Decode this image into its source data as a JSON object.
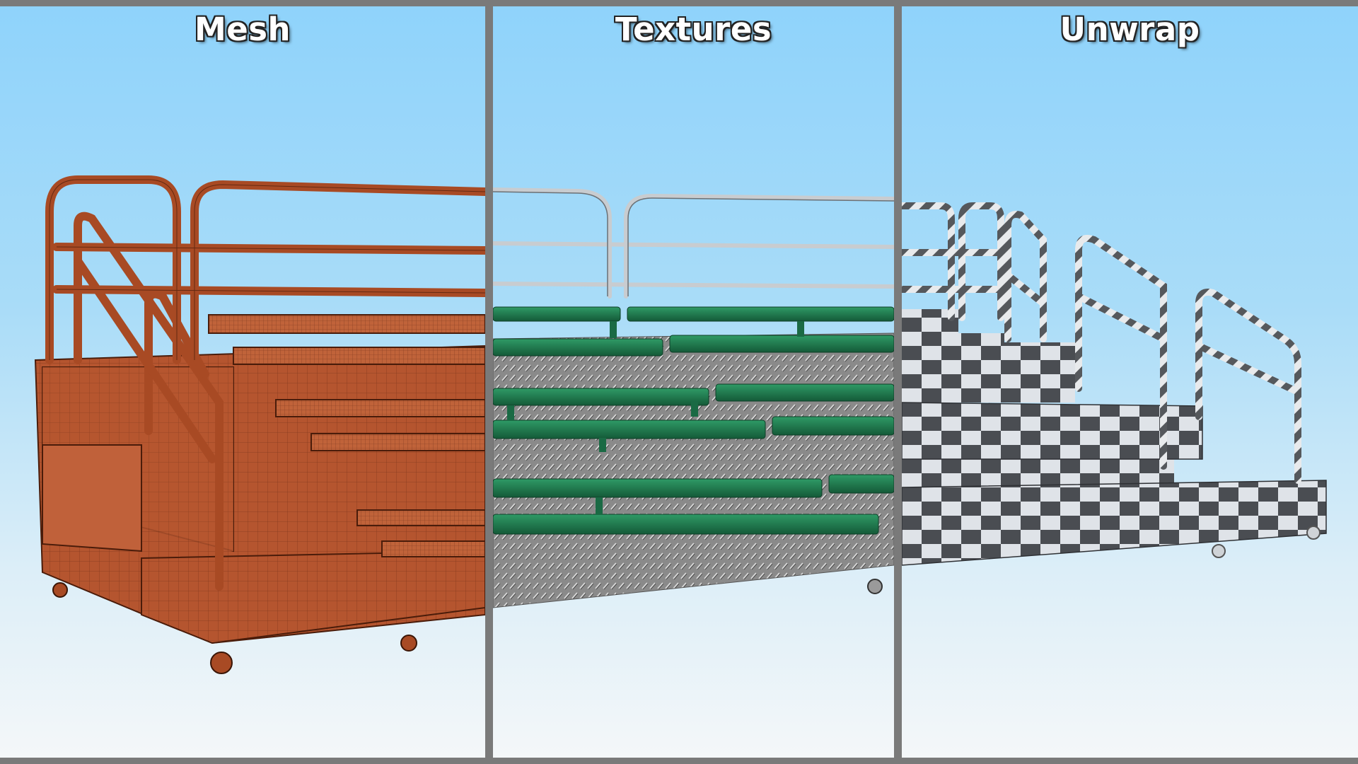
{
  "panels": [
    {
      "id": "mesh",
      "title": "Mesh"
    },
    {
      "id": "textures",
      "title": "Textures"
    },
    {
      "id": "unwrap",
      "title": "Unwrap"
    }
  ],
  "colors": {
    "frame": "#7a7a7a",
    "sky_top": "#8fd3fb",
    "sky_bottom": "#f4f7f9",
    "mesh_wood": "#b5552f",
    "texture_bench": "#1f7a4e",
    "texture_plate": "#8c8c8c",
    "rail_metal": "#c8ccd0",
    "checker_dark": "#4a4d52",
    "checker_light": "#dfe3e8"
  }
}
